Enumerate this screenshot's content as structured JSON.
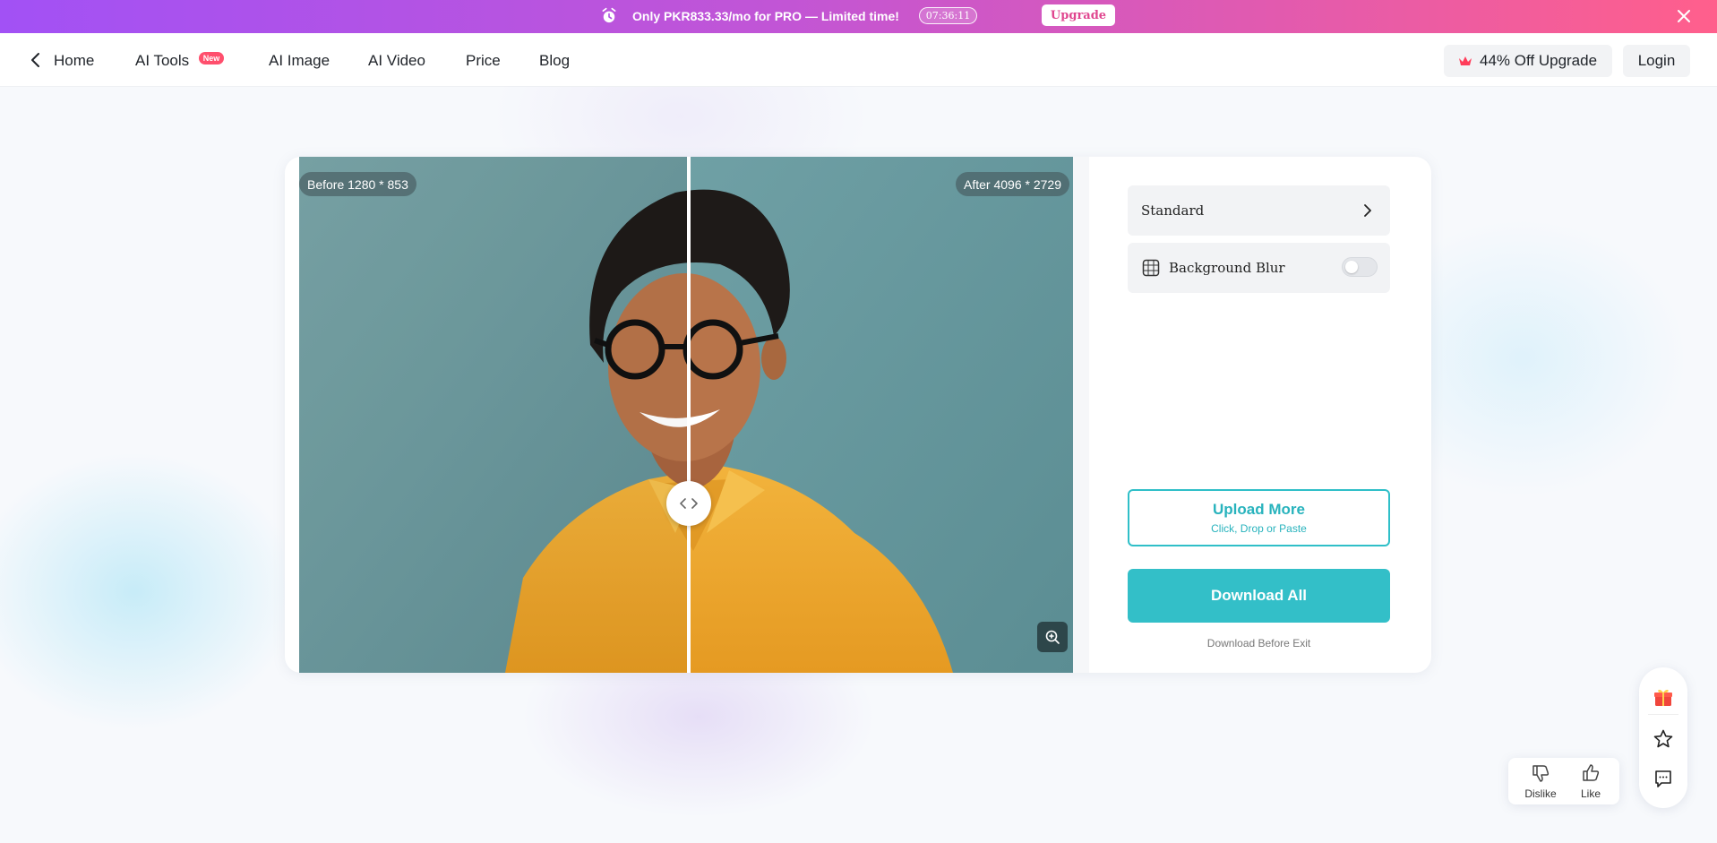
{
  "promo": {
    "message": "Only PKR833.33/mo for PRO — Limited time!",
    "timer": "07:36:11",
    "upgrade_label": "Upgrade",
    "icons": [
      "alarm-clock-icon",
      "close-icon"
    ]
  },
  "nav": {
    "home_label": "Home",
    "ai_tools_label": "AI Tools",
    "new_badge": "New",
    "ai_image_label": "AI Image",
    "ai_video_label": "AI Video",
    "price_label": "Price",
    "blog_label": "Blog",
    "upgrade_offer_label": "44% Off Upgrade",
    "login_label": "Login"
  },
  "viewer": {
    "before_label": "Before 1280 * 853",
    "after_label": "After 4096 * 2729",
    "split_position": 0.5
  },
  "panel": {
    "mode_label": "Standard",
    "background_blur_label": "Background Blur",
    "background_blur_on": false,
    "upload_title": "Upload More",
    "upload_subtitle": "Click, Drop or Paste",
    "download_label": "Download All",
    "download_note": "Download Before Exit"
  },
  "feedback": {
    "dislike_label": "Dislike",
    "like_label": "Like"
  },
  "colors": {
    "accent_teal": "#33bfc8",
    "promo_start": "#a251f5",
    "promo_end": "#ff5f8c",
    "badge_red": "#ff4f6d"
  }
}
